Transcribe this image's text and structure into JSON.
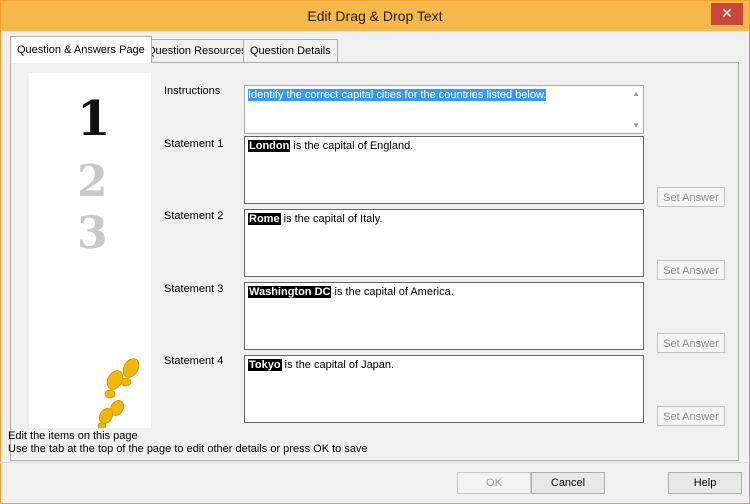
{
  "window": {
    "title": "Edit Drag & Drop Text",
    "close_glyph": "✕"
  },
  "tabs": [
    {
      "label": "Question & Answers Page",
      "active": true
    },
    {
      "label": "Question Resources",
      "active": false
    },
    {
      "label": "Question Details",
      "active": false
    }
  ],
  "instructions": {
    "label": "Instructions",
    "value": "Identify the correct capital cities for the countries listed below."
  },
  "statements": [
    {
      "label": "Statement 1",
      "answer": "London",
      "rest": " is the capital of England.",
      "button": "Set Answer"
    },
    {
      "label": "Statement 2",
      "answer": "Rome",
      "rest": " is the capital of Italy.",
      "button": "Set Answer"
    },
    {
      "label": "Statement 3",
      "answer": "Washington DC",
      "rest": " is the capital of America.",
      "button": "Set Answer"
    },
    {
      "label": "Statement 4",
      "answer": "Tokyo",
      "rest": " is the capital of Japan.",
      "button": "Set Answer"
    }
  ],
  "hint": {
    "line1": "Edit the items on this page",
    "line2": "Use the tab at the top of the page to edit other details or press OK to save"
  },
  "buttons": {
    "ok": "OK",
    "cancel": "Cancel",
    "help": "Help"
  },
  "step_numbers": [
    "1",
    "2",
    "3"
  ],
  "colors": {
    "titlebar": "#f6b84a",
    "close": "#c7473b",
    "selection": "#3399ff",
    "footprints": "#f2b705"
  }
}
